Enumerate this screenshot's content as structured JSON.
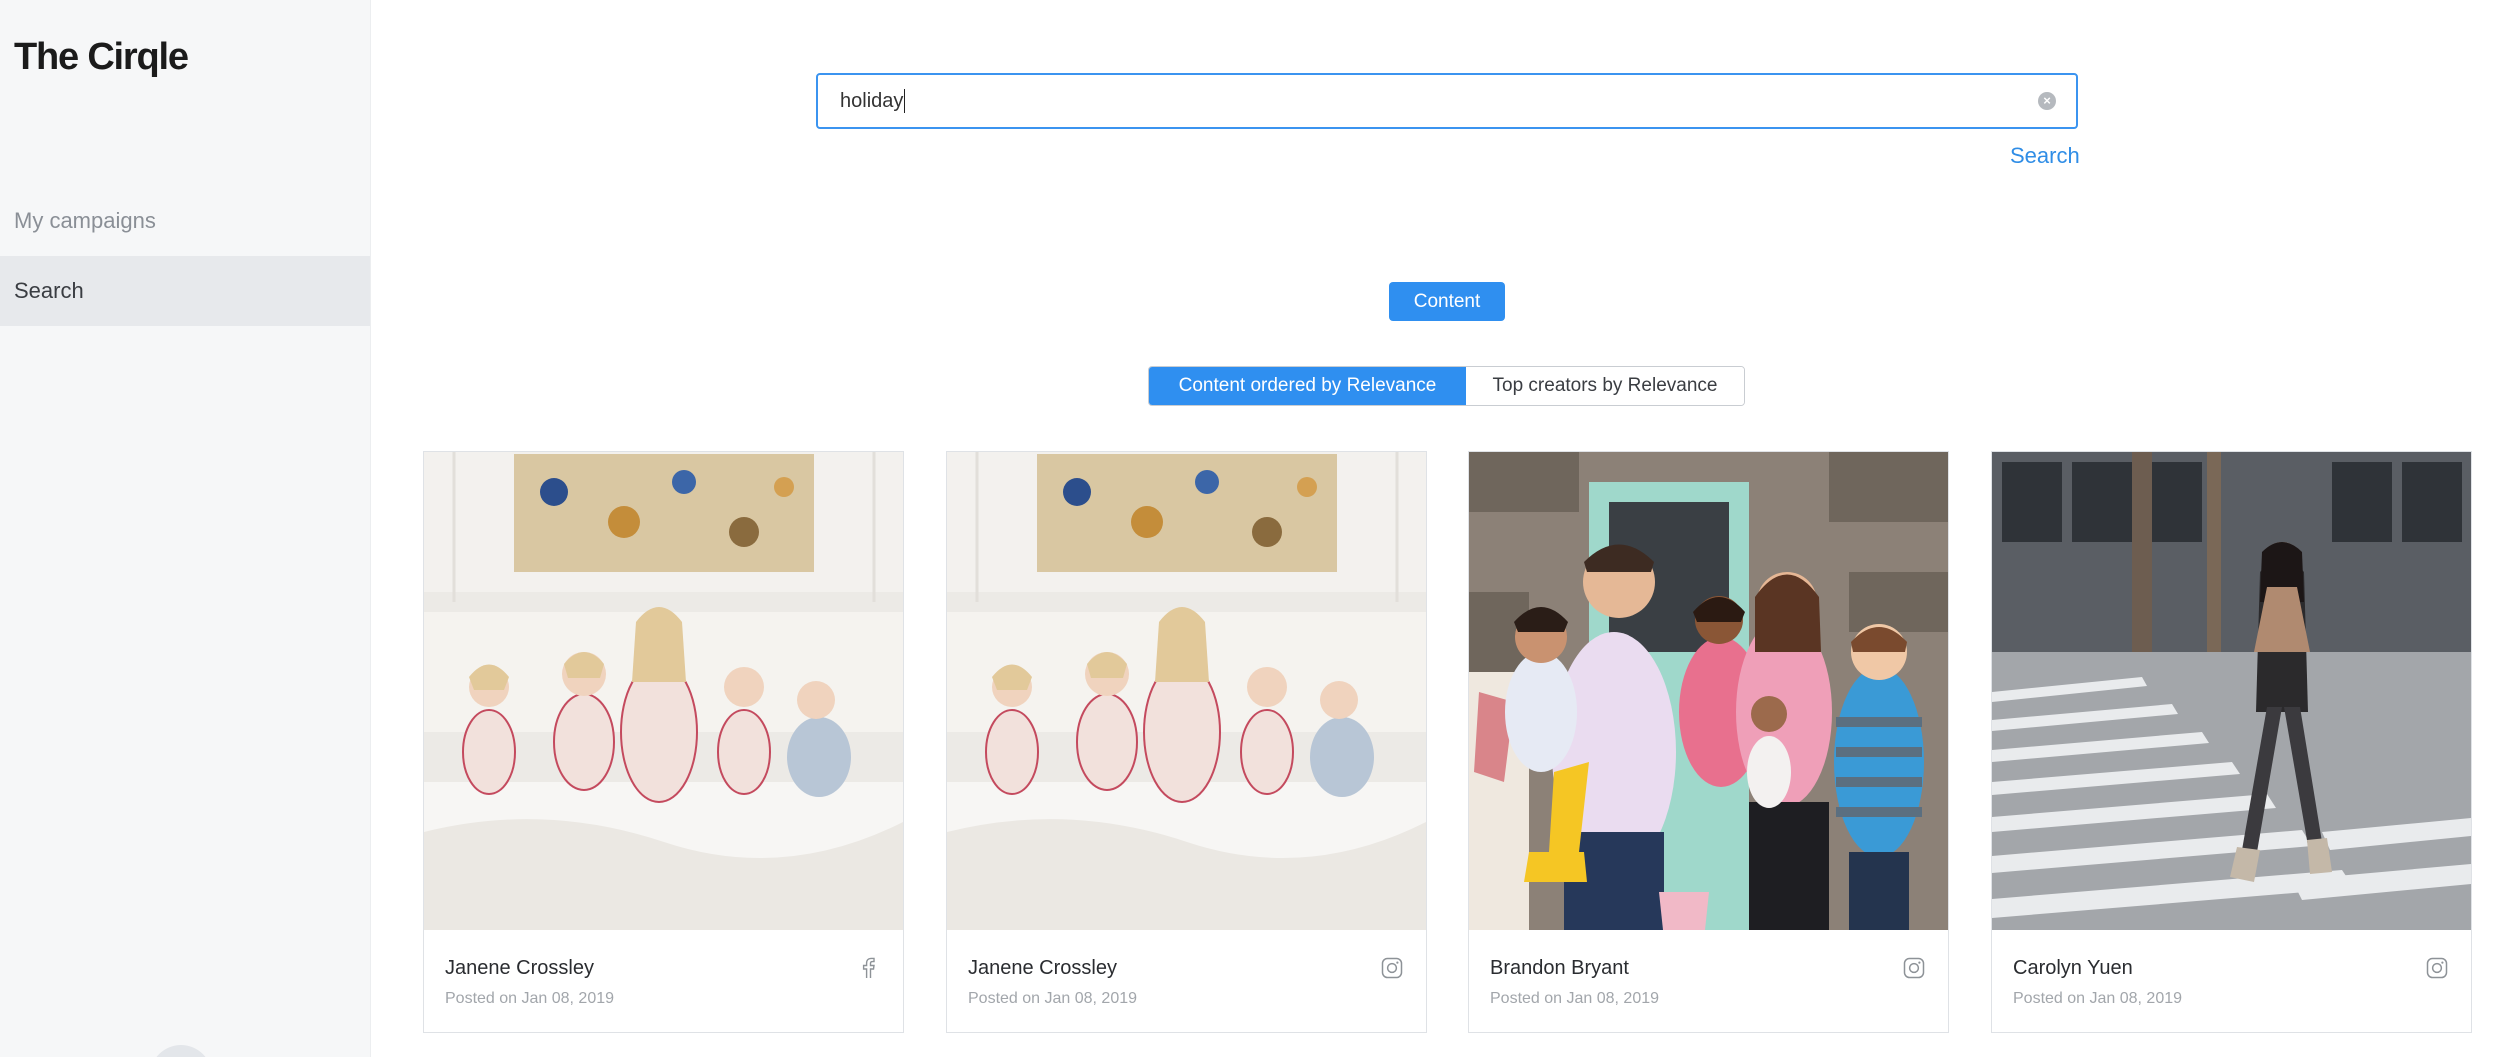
{
  "app": {
    "logo": "The Cirqle"
  },
  "sidebar": {
    "items": [
      {
        "label": "My campaigns",
        "active": false
      },
      {
        "label": "Search",
        "active": true
      }
    ]
  },
  "search": {
    "value": "holiday",
    "submit_label": "Search"
  },
  "filters": {
    "content_button": "Content"
  },
  "sort_tabs": [
    {
      "label": "Content ordered by Relevance",
      "active": true
    },
    {
      "label": "Top creators by Relevance",
      "active": false
    }
  ],
  "cards": [
    {
      "name": "Janene Crossley",
      "date": "Posted on Jan 08, 2019",
      "platform_icon": "facebook-icon"
    },
    {
      "name": "Janene Crossley",
      "date": "Posted on Jan 08, 2019",
      "platform_icon": "instagram-icon"
    },
    {
      "name": "Brandon Bryant",
      "date": "Posted on Jan 08, 2019",
      "platform_icon": "instagram-icon"
    },
    {
      "name": "Carolyn Yuen",
      "date": "Posted on Jan 08, 2019",
      "platform_icon": "instagram-icon"
    }
  ],
  "colors": {
    "accent": "#2f8ff0",
    "sidebar_bg": "#f6f7f8",
    "active_nav_bg": "#e7e9ec"
  }
}
